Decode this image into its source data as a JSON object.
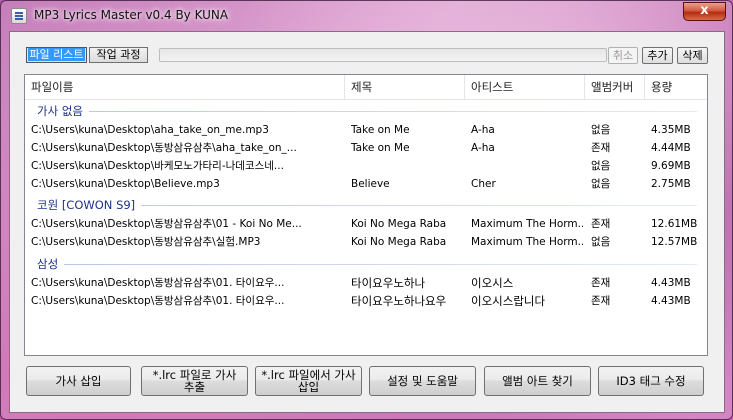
{
  "window": {
    "title": "MP3 Lyrics Master v0.4 By KUNA",
    "close_label": "x"
  },
  "tabs": [
    {
      "label": "파일 리스트",
      "active": true
    },
    {
      "label": "작업 과정",
      "active": false
    }
  ],
  "progress": {
    "value": 0
  },
  "toolbar": {
    "cancel_label": "취소",
    "add_label": "추가",
    "delete_label": "삭제"
  },
  "columns": [
    "파일이름",
    "제목",
    "아티스트",
    "앨범커버",
    "용량"
  ],
  "groups": [
    {
      "label": "가사 없음",
      "rows": [
        {
          "filename": "C:\\Users\\kuna\\Desktop\\aha_take_on_me.mp3",
          "title": "Take on Me",
          "artist": "A-ha",
          "cover": "없음",
          "size": "4.35MB"
        },
        {
          "filename": "C:\\Users\\kuna\\Desktop\\동방삼유삼추\\aha_take_on_...",
          "title": "Take on Me",
          "artist": "A-ha",
          "cover": "존재",
          "size": "4.44MB"
        },
        {
          "filename": "C:\\Users\\kuna\\Desktop\\바케모노가타리-나데코스네...",
          "title": "",
          "artist": "",
          "cover": "없음",
          "size": "9.69MB"
        },
        {
          "filename": "C:\\Users\\kuna\\Desktop\\Believe.mp3",
          "title": "Believe",
          "artist": "Cher",
          "cover": "없음",
          "size": "2.75MB"
        }
      ]
    },
    {
      "label": "코원 [COWON S9]",
      "rows": [
        {
          "filename": "C:\\Users\\kuna\\Desktop\\동방삼유삼추\\01 - Koi No Me...",
          "title": "Koi No Mega Raba",
          "artist": "Maximum The Horm...",
          "cover": "존재",
          "size": "12.61MB"
        },
        {
          "filename": "C:\\Users\\kuna\\Desktop\\동방삼유삼추\\실험.MP3",
          "title": "Koi No Mega Raba",
          "artist": "Maximum The Horm...",
          "cover": "없음",
          "size": "12.57MB"
        }
      ]
    },
    {
      "label": "삼성",
      "rows": [
        {
          "filename": "C:\\Users\\kuna\\Desktop\\동방삼유삼추\\01. 타이요우...",
          "title": "타이요우노하나",
          "artist": "이오시스",
          "cover": "존재",
          "size": "4.43MB"
        },
        {
          "filename": "C:\\Users\\kuna\\Desktop\\동방삼유삼추\\01. 타이요우...",
          "title": "타이요우노하나요우",
          "artist": "이오시스랍니다",
          "cover": "존재",
          "size": "4.43MB"
        }
      ]
    }
  ],
  "buttons": {
    "insert_lyrics": "가사 삽입",
    "extract_to_lrc": "*.lrc 파일로 가사 추출",
    "insert_from_lrc": "*.lrc 파일에서 가사 삽입",
    "settings_help": "설정 및 도움말",
    "find_album_art": "앨범 아트 찾기",
    "edit_id3": "ID3 태그 수정"
  }
}
